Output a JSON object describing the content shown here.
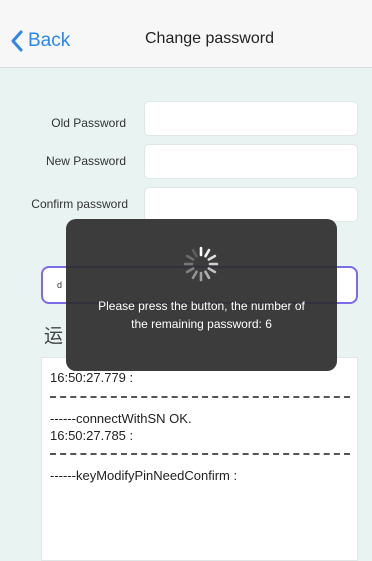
{
  "nav": {
    "back_label": "Back",
    "title": "Change password"
  },
  "form": {
    "old_label": "Old Password",
    "new_label": "New Password",
    "confirm_label": "Confirm password",
    "old_value": "",
    "new_value": "",
    "confirm_value": ""
  },
  "action_button_label": "d",
  "log": {
    "title": "运",
    "entries": [
      "16:50:27.779 :",
      "------connectWithSN OK.",
      "16:50:27.785 :",
      "------keyModifyPinNeedConfirm :"
    ]
  },
  "toast": {
    "line1": "Please press the button, the number of",
    "line2": "the remaining password: 6"
  },
  "colors": {
    "accent": "#2c86f0",
    "background": "#e8f3f2",
    "button_border": "#7b6be6",
    "toast_bg": "#2d2d2d"
  },
  "icons": {
    "back": "chevron-left-icon",
    "loading": "spinner-icon"
  }
}
